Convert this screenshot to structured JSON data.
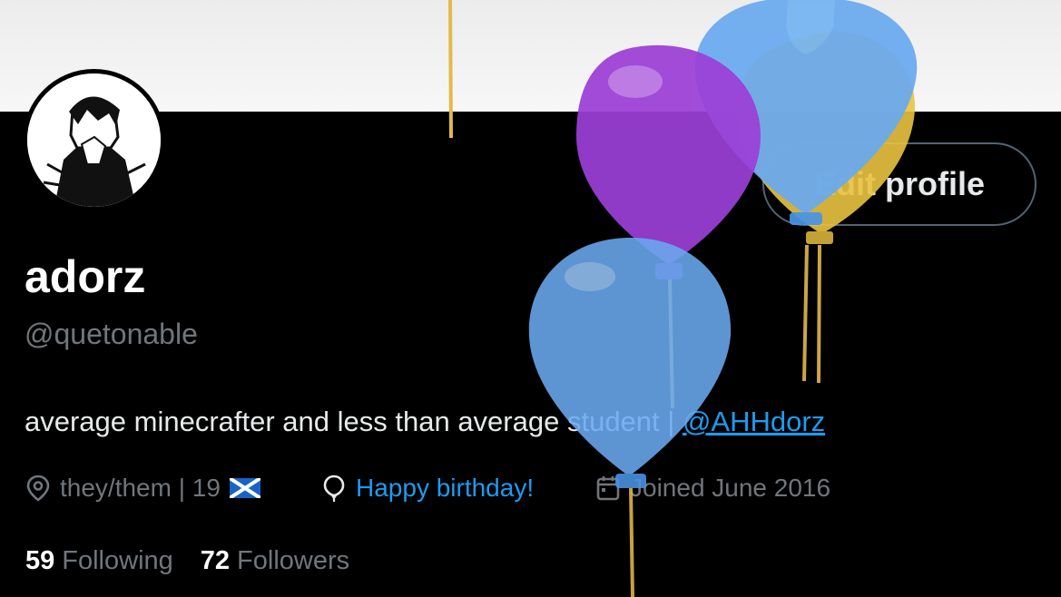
{
  "profile": {
    "display_name": "adorz",
    "handle": "@quetonable",
    "bio_text": "average minecrafter and less than average student | ",
    "bio_link": "@AHHdorz",
    "edit_button": "Edit profile"
  },
  "meta": {
    "location": "they/them | 19",
    "location_icon": "location-pin-icon",
    "flag": "scotland-flag",
    "birthday": "Happy birthday!",
    "birthday_icon": "balloon-icon",
    "joined": "Joined June 2016",
    "joined_icon": "calendar-icon"
  },
  "stats": {
    "following_count": "59",
    "following_label": "Following",
    "followers_count": "72",
    "followers_label": "Followers"
  },
  "colors": {
    "accent": "#1d9bf0",
    "muted": "#71767b",
    "balloon_purple": "#9b3fd6",
    "balloon_blue": "#6aaaf0",
    "balloon_yellow": "#e9c441"
  }
}
